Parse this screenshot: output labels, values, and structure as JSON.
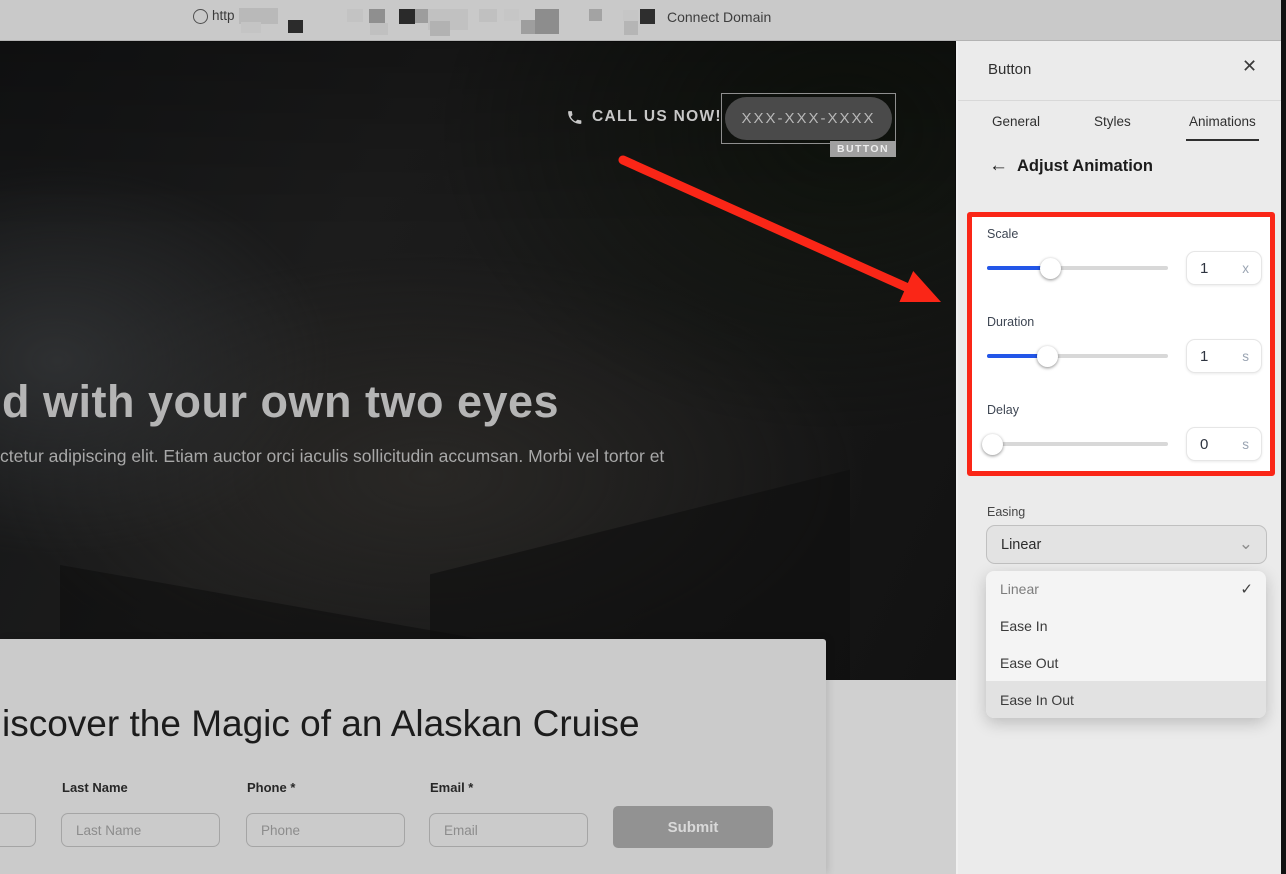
{
  "topbar": {
    "url_prefix": "http",
    "connect_domain_label": "Connect Domain"
  },
  "hero": {
    "call_us_label": "CALL US NOW!",
    "button_label": "XXX-XXX-XXXX",
    "selection_tag": "BUTTON",
    "heading": "d with your own two eyes",
    "paragraph": "ctetur adipiscing elit. Etiam auctor orci iaculis sollicitudin accumsan. Morbi vel tortor et"
  },
  "form_section": {
    "heading": "iscover the Magic of an Alaskan Cruise",
    "fields": [
      {
        "label": "Last Name",
        "placeholder": "Last Name"
      },
      {
        "label": "Phone *",
        "placeholder": "Phone"
      },
      {
        "label": "Email *",
        "placeholder": "Email"
      }
    ],
    "submit_label": "Submit"
  },
  "panel": {
    "title": "Button",
    "close_glyph": "✕",
    "tabs": [
      {
        "label": "General",
        "active": false
      },
      {
        "label": "Styles",
        "active": false
      },
      {
        "label": "Animations",
        "active": true
      }
    ],
    "back_glyph": "←",
    "subtitle": "Adjust Animation",
    "sliders": [
      {
        "label": "Scale",
        "value": "1",
        "unit": "x",
        "fill_pct": 35
      },
      {
        "label": "Duration",
        "value": "1",
        "unit": "s",
        "fill_pct": 33
      },
      {
        "label": "Delay",
        "value": "0",
        "unit": "s",
        "fill_pct": 3
      }
    ],
    "easing": {
      "label": "Easing",
      "selected": "Linear",
      "chevron_glyph": "⌄",
      "options": [
        {
          "label": "Linear",
          "check": "✓",
          "highlighted": false
        },
        {
          "label": "Ease In",
          "check": "",
          "highlighted": false
        },
        {
          "label": "Ease Out",
          "check": "",
          "highlighted": false
        },
        {
          "label": "Ease In Out",
          "check": "",
          "highlighted": true
        }
      ]
    }
  },
  "colors": {
    "highlight_red": "#fa2617",
    "slider_blue": "#2356e8"
  }
}
